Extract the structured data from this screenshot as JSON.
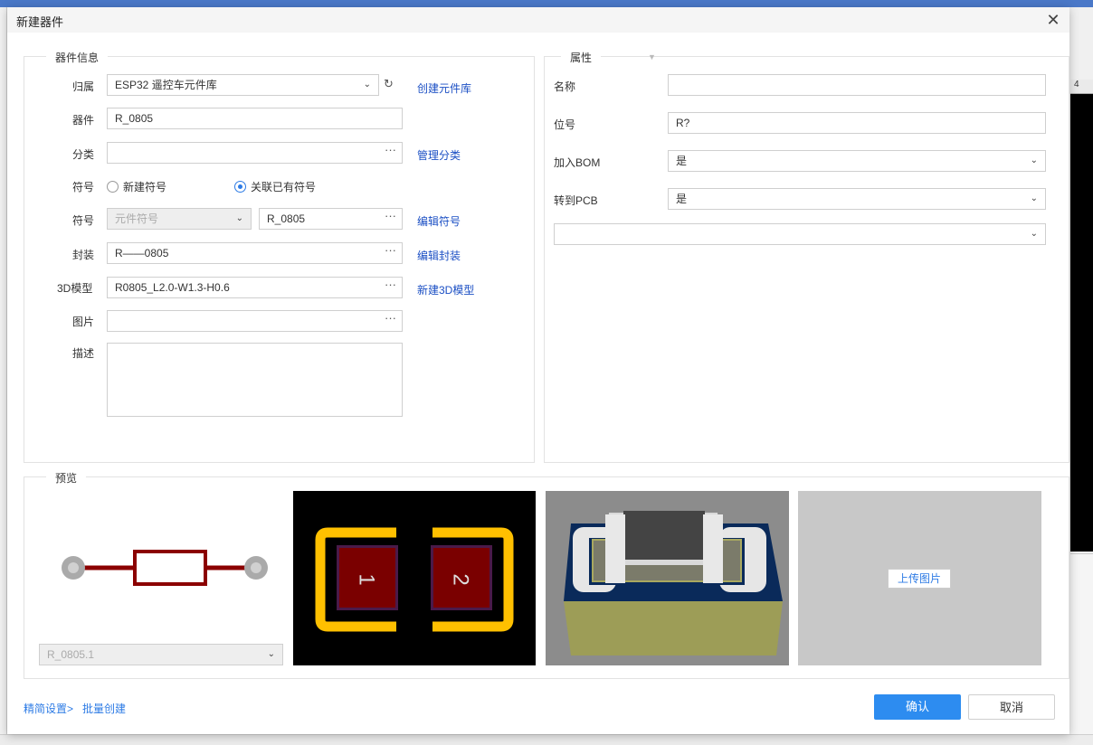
{
  "dialog": {
    "title": "新建器件",
    "close_icon": "close-icon"
  },
  "info": {
    "legend": "器件信息",
    "belong_label": "归属",
    "belong_value": "ESP32 遥控车元件库",
    "create_lib_link": "创建元件库",
    "device_label": "器件",
    "device_value": "R_0805",
    "category_label": "分类",
    "category_value": "",
    "manage_category_link": "管理分类",
    "symbol_mode_label": "符号",
    "symbol_new_option": "新建符号",
    "symbol_existing_option": "关联已有符号",
    "symbol_label": "符号",
    "symbol_type_placeholder": "元件符号",
    "symbol_value": "R_0805",
    "edit_symbol_link": "编辑符号",
    "footprint_label": "封装",
    "footprint_value": "R——0805",
    "edit_footprint_link": "编辑封装",
    "model3d_label": "3D模型",
    "model3d_value": "R0805_L2.0-W1.3-H0.6",
    "new_3d_link": "新建3D模型",
    "image_label": "图片",
    "image_value": "",
    "desc_label": "描述",
    "desc_value": "",
    "dots": "···"
  },
  "props": {
    "legend": "属性",
    "name_label": "名称",
    "name_value": "",
    "designator_label": "位号",
    "designator_value": "R?",
    "bom_label": "加入BOM",
    "bom_value": "是",
    "pcb_label": "转到PCB",
    "pcb_value": "是",
    "extra_value": ""
  },
  "preview": {
    "legend": "预览",
    "symbol_select": "R_0805.1",
    "pad1_label": "1",
    "pad2_label": "2",
    "upload_button": "上传图片",
    "colors": {
      "symbol_wire": "#8b0000",
      "pad_outline": "#ffc000",
      "pad_fill": "#7a0000",
      "pcb_bg": "#000000",
      "model_bg": "#8c8c8c",
      "model_base": "#9d9d57",
      "upload_bg": "#c8c8c8"
    }
  },
  "footer": {
    "simple_settings_link": "精简设置>",
    "batch_create_link": "批量创建",
    "confirm_button": "确认",
    "cancel_button": "取消"
  },
  "background": {
    "ruler_text": "4"
  }
}
